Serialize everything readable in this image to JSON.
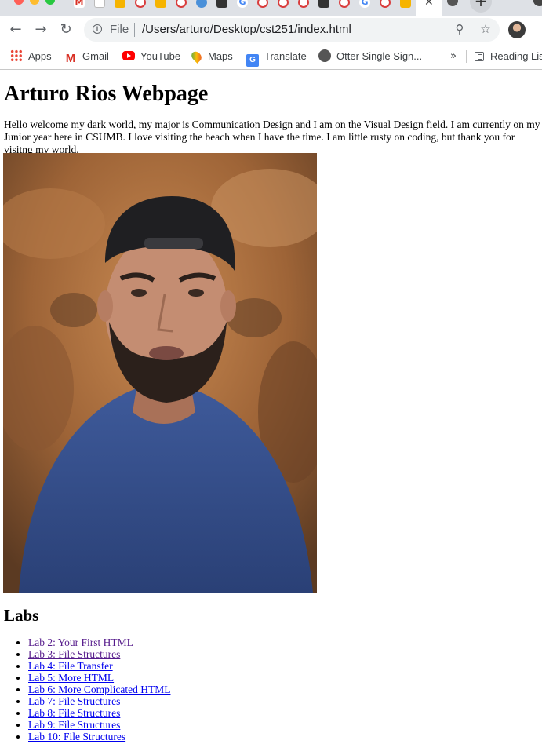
{
  "browser": {
    "omnibox": {
      "scheme": "File",
      "url": "/Users/arturo/Desktop/cst251/index.html"
    },
    "bookmarks": [
      {
        "label": "Apps",
        "icon": "apps-icon"
      },
      {
        "label": "Gmail",
        "icon": "gmail-icon"
      },
      {
        "label": "YouTube",
        "icon": "youtube-icon"
      },
      {
        "label": "Maps",
        "icon": "maps-icon"
      },
      {
        "label": "Translate",
        "icon": "translate-icon"
      },
      {
        "label": "Otter Single Sign...",
        "icon": "globe-icon"
      }
    ],
    "bookmarks_overflow": "»",
    "reading_list": "Reading List"
  },
  "page": {
    "title": "Arturo Rios Webpage",
    "intro": "Hello welcome my dark world, my major is Communication Design and I am on the Visual Design field. I am currently on my Junior year here in CSUMB. I love visiting the beach when I have the time. I am little rusty on coding, but thank you for visitng my world.",
    "labs_heading": "Labs",
    "labs": [
      {
        "label": "Lab 2: Your First HTML",
        "visited": true
      },
      {
        "label": "Lab 3: File Structures",
        "visited": true
      },
      {
        "label": "Lab 4: File Transfer",
        "visited": false
      },
      {
        "label": "Lab 5: More HTML",
        "visited": false
      },
      {
        "label": "Lab 6: More Complicated HTML",
        "visited": false
      },
      {
        "label": "Lab 7: File Structures",
        "visited": false
      },
      {
        "label": "Lab 8: File Structures",
        "visited": false
      },
      {
        "label": "Lab 9: File Structures",
        "visited": false
      },
      {
        "label": "Lab 10: File Structures",
        "visited": false
      }
    ]
  },
  "colors": {
    "link": "#0000ee",
    "visited_link": "#551a8b",
    "chrome_tabstrip": "#dee1e6",
    "omnibox_bg": "#f1f3f4"
  }
}
